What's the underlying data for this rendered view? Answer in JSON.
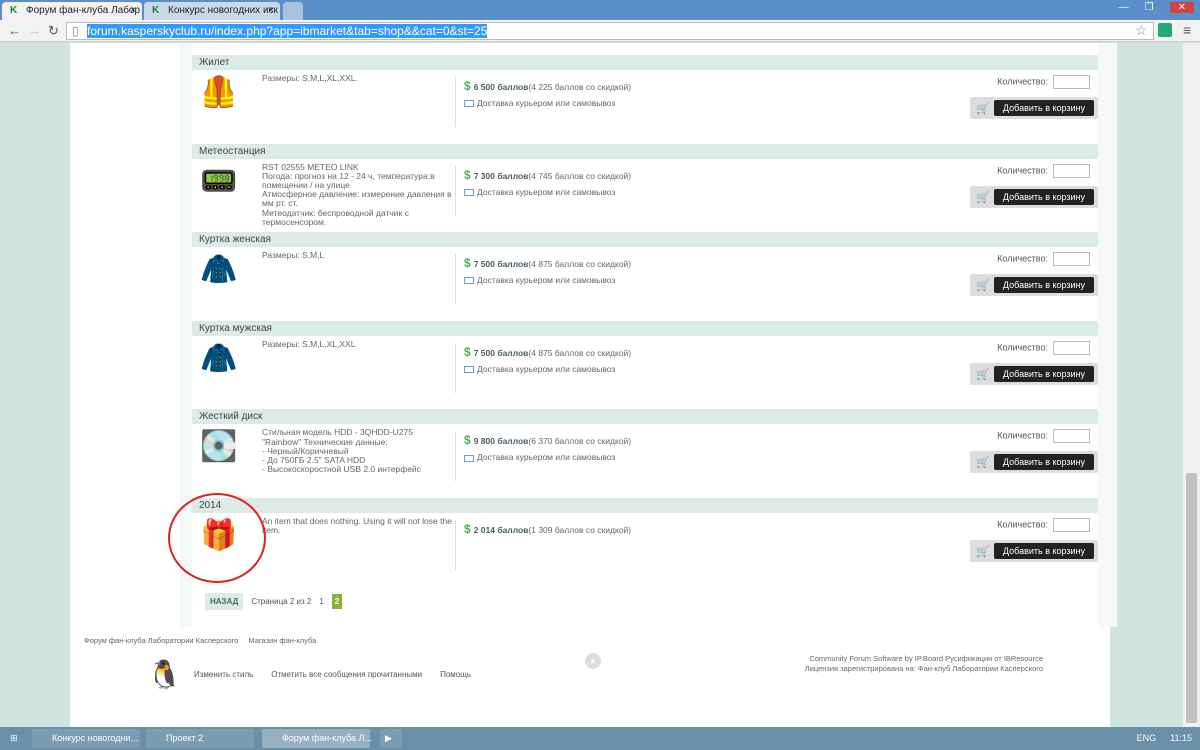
{
  "browser": {
    "tabs": [
      "Форум фан-клуба Лабор",
      "Конкурс новогодних иск"
    ],
    "url_selected": "forum.kasperskyclub.ru/index.php?app=ibmarket&tab=shop&&cat=0&st=25"
  },
  "shop": {
    "qty_label": "Количество:",
    "buy_label": "Добавить в корзину",
    "delivery": "Доставка курьером или самовывоз",
    "items": [
      {
        "title": "Жилет",
        "desc": "Размеры: S,M,L,XL,XXL.",
        "price": "6 500 баллов",
        "discount": "(4 225 баллов со скидкой)",
        "icon": "vest"
      },
      {
        "title": "Метеостанция",
        "desc": "RST 02555 METEO LINK\nПогода: прогноз на 12 - 24 ч, температура:в помещении / на улице\nАтмосферное давление: измерение давления в мм рт. ст.\nМетеодатчик: беспроводной датчик с термосенсором.",
        "price": "7 300 баллов",
        "discount": "(4 745 баллов со скидкой)",
        "icon": "weather-station"
      },
      {
        "title": "Куртка женская",
        "desc": "Размеры: S,M,L",
        "price": "7 500 баллов",
        "discount": "(4 875 баллов со скидкой)",
        "icon": "jacket-green"
      },
      {
        "title": "Куртка мужская",
        "desc": "Размеры: S,M,L,XL,XXL",
        "price": "7 500 баллов",
        "discount": "(4 875 баллов со скидкой)",
        "icon": "jacket-dark"
      },
      {
        "title": "Жесткий диск",
        "desc": "Стильная модель HDD - 3QHDD-U275 \"Rainbow\" Технические данные:\n- Черный/Коричневый\n- До 750ГБ 2.5\" SATA HDD\n- Высокоскоростной USB 2.0 интерфейс",
        "price": "9 800 баллов",
        "discount": "(6 370 баллов со скидкой)",
        "icon": "hard-disk"
      },
      {
        "title": "2014",
        "desc": "An item that does nothing. Using it will not lose the item.",
        "price": "2 014 баллов",
        "discount": "(1 309 баллов со скидкой)",
        "icon": "gift-2014",
        "nodelivery": true
      }
    ]
  },
  "pager": {
    "back": "НАЗАД",
    "status": "Страница 2 из 2",
    "p1": "1",
    "p2": "2"
  },
  "footer": {
    "links": [
      "Форум фан-клуба Лаборатории Касперского",
      "Магазин фан-клуба"
    ],
    "nav": [
      "Изменить стиль",
      "Отметить все сообщения прочитанными",
      "Помощь"
    ],
    "credit1": "Community Forum Software by IP.Board Русификация от IBResource",
    "credit2": "Лицензия зарегистрирована на: Фан-клуб Лаборатории Касперского"
  },
  "taskbar": {
    "items": [
      "Конкурс новогодни...",
      "Проект 2",
      "Форум фан-клуба Л..."
    ],
    "lang": "ENG",
    "time": "11:15"
  }
}
